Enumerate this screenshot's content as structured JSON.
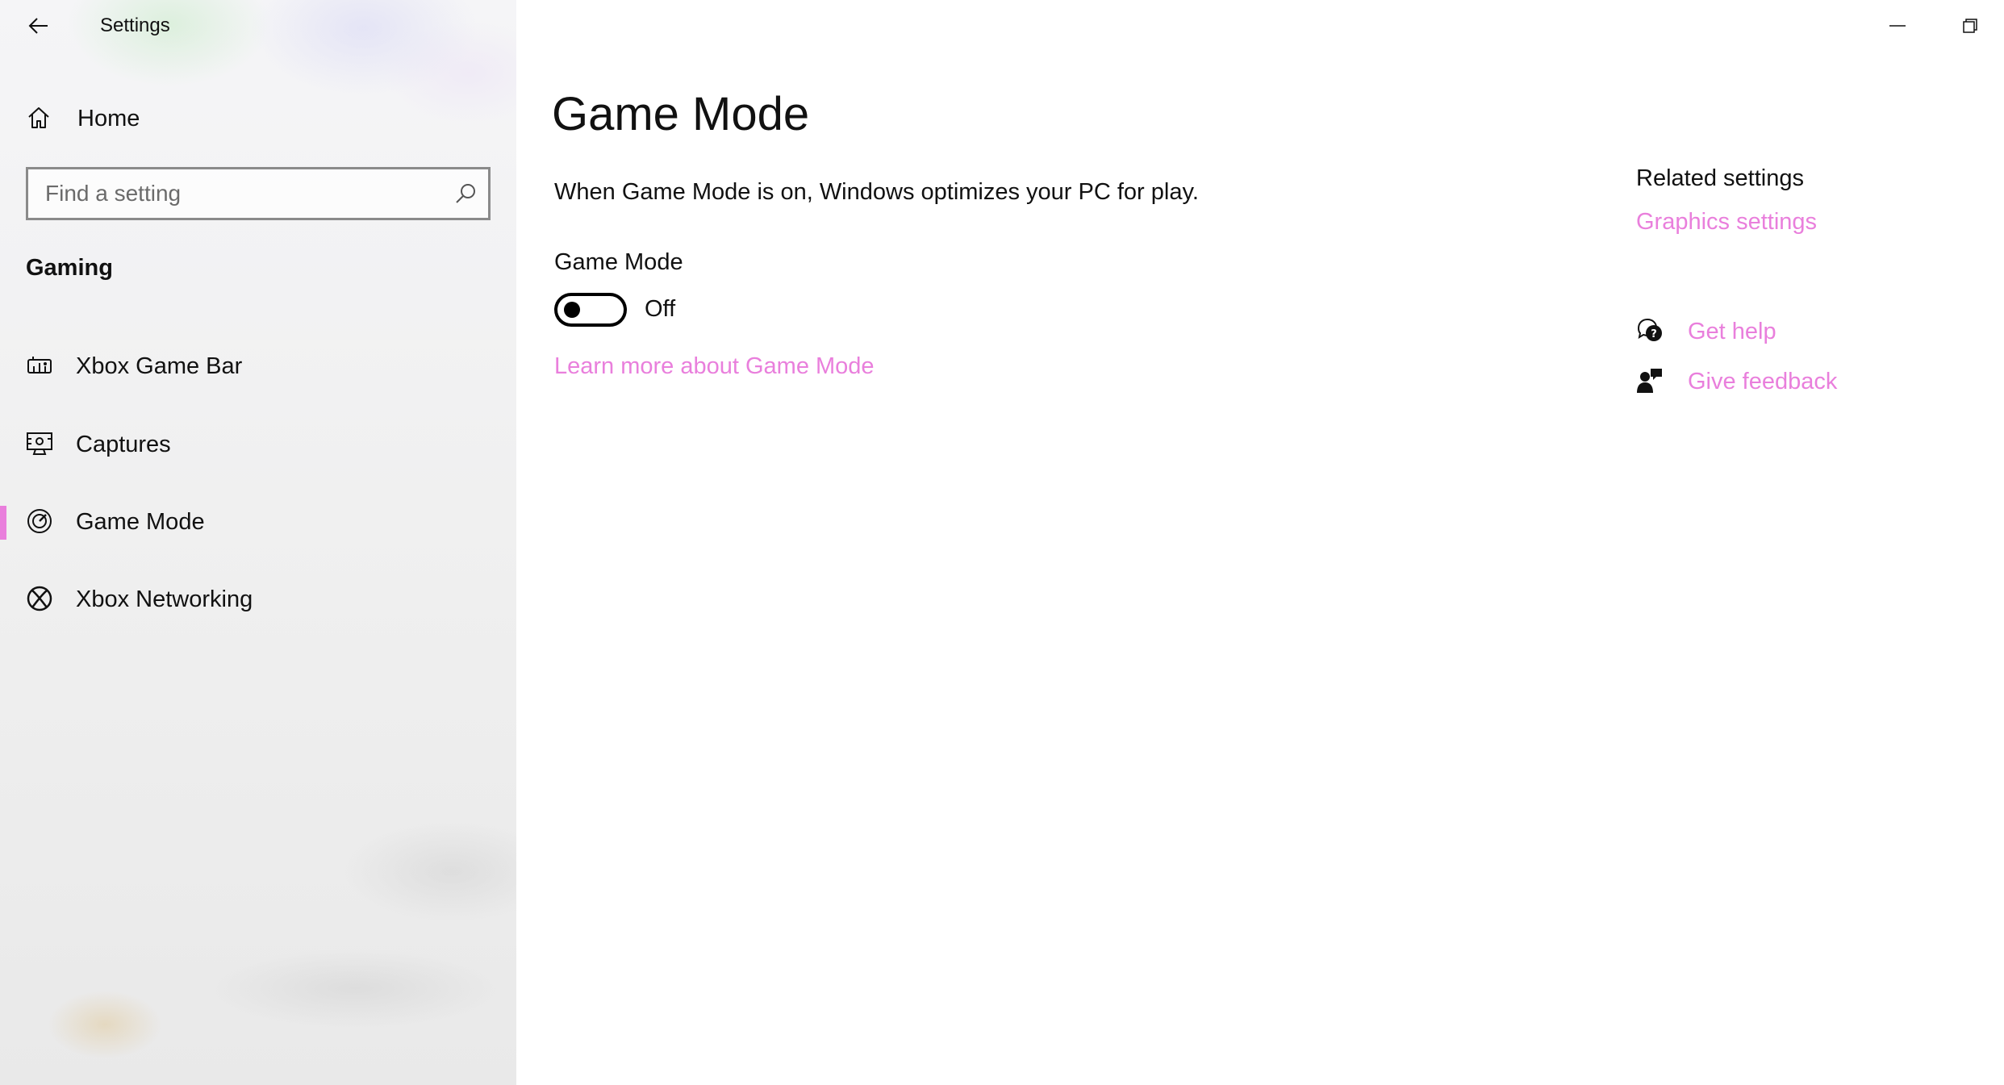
{
  "window": {
    "title": "Settings",
    "back_icon": "back-arrow-icon",
    "minimize_icon": "minimize-icon",
    "restore_icon": "restore-icon"
  },
  "sidebar": {
    "home": {
      "label": "Home",
      "icon": "home-icon"
    },
    "search": {
      "placeholder": "Find a setting",
      "value": "",
      "icon": "search-icon"
    },
    "section_heading": "Gaming",
    "items": [
      {
        "label": "Xbox Game Bar",
        "icon": "xbox-game-bar-icon",
        "selected": false
      },
      {
        "label": "Captures",
        "icon": "captures-icon",
        "selected": false
      },
      {
        "label": "Game Mode",
        "icon": "game-mode-icon",
        "selected": true
      },
      {
        "label": "Xbox Networking",
        "icon": "xbox-icon",
        "selected": false
      }
    ]
  },
  "main": {
    "title": "Game Mode",
    "description": "When Game Mode is on, Windows optimizes your PC for play.",
    "toggle": {
      "label": "Game Mode",
      "state": "Off",
      "on": false
    },
    "learn_more_link": "Learn more about Game Mode"
  },
  "related": {
    "heading": "Related settings",
    "graphics_link": "Graphics settings",
    "get_help": {
      "label": "Get help",
      "icon": "get-help-icon"
    },
    "give_feedback": {
      "label": "Give feedback",
      "icon": "give-feedback-icon"
    }
  },
  "colors": {
    "accent": "#e97fdc",
    "text": "#111111",
    "sidebar_bg": "#efefef"
  }
}
